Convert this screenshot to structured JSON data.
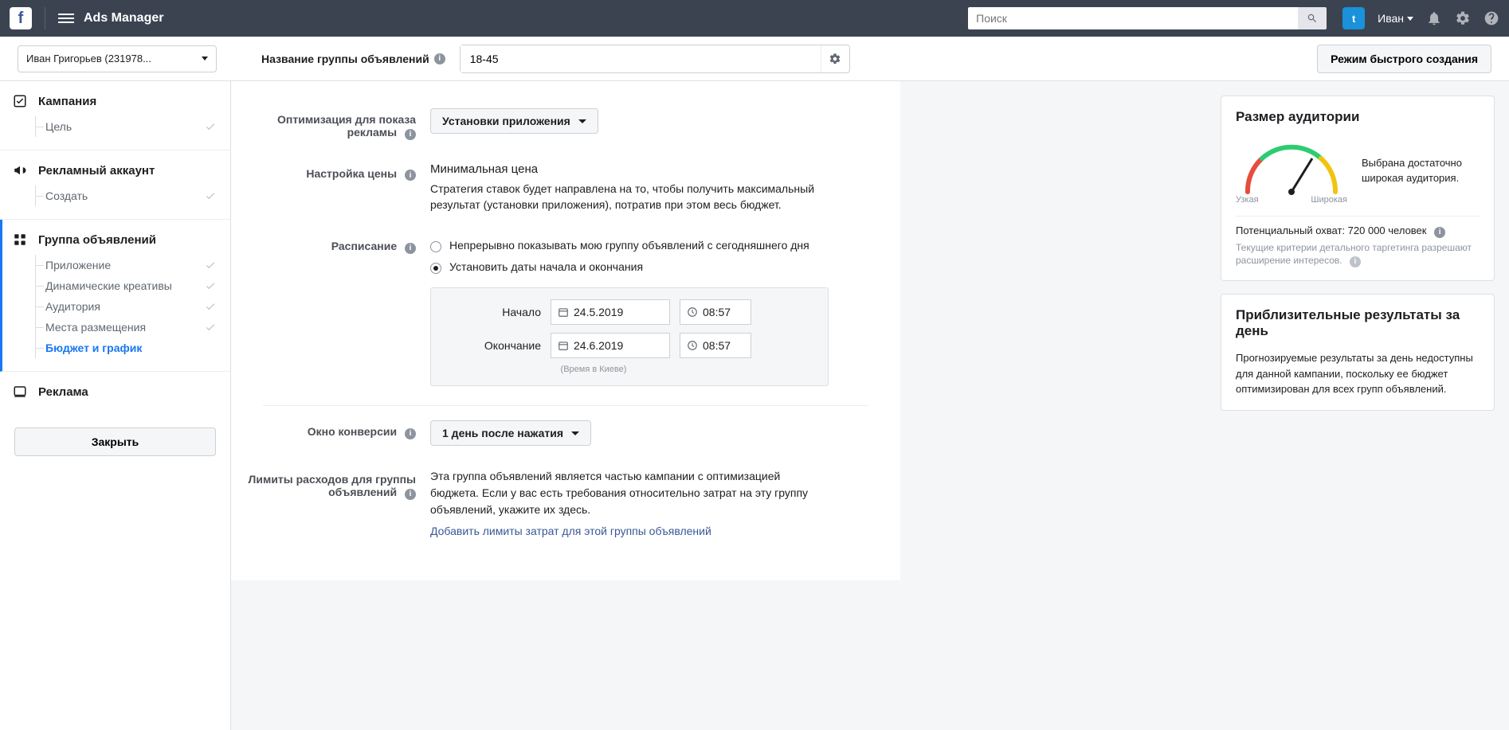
{
  "topbar": {
    "title": "Ads Manager",
    "search_placeholder": "Поиск",
    "user_name": "Иван"
  },
  "secondbar": {
    "account": "Иван Григорьев (231978...",
    "adset_label": "Название группы объявлений",
    "adset_value": "18-45",
    "quick_button": "Режим быстрого создания"
  },
  "sidebar": {
    "campaign": {
      "title": "Кампания",
      "sub_goal": "Цель"
    },
    "adaccount": {
      "title": "Рекламный аккаунт",
      "sub_create": "Создать"
    },
    "adset": {
      "title": "Группа объявлений",
      "subs": {
        "app": "Приложение",
        "dynamic": "Динамические креативы",
        "audience": "Аудитория",
        "placements": "Места размещения",
        "budget": "Бюджет и график"
      }
    },
    "ad": {
      "title": "Реклама"
    },
    "close": "Закрыть"
  },
  "form": {
    "optimization": {
      "label": "Оптимизация для показа рекламы",
      "value": "Установки приложения"
    },
    "price": {
      "label": "Настройка цены",
      "title": "Минимальная цена",
      "desc": "Стратегия ставок будет направлена на то, чтобы получить максимальный результат (установки приложения), потратив при этом весь бюджет."
    },
    "schedule": {
      "label": "Расписание",
      "opt_continuous": "Непрерывно показывать мою группу объявлений с сегодняшнего дня",
      "opt_dates": "Установить даты начала и окончания",
      "start_label": "Начало",
      "end_label": "Окончание",
      "start_date": "24.5.2019",
      "end_date": "24.6.2019",
      "start_time": "08:57",
      "end_time": "08:57",
      "tz": "(Время в Киеве)"
    },
    "window": {
      "label": "Окно конверсии",
      "value": "1 день после нажатия"
    },
    "limits": {
      "label": "Лимиты расходов для группы объявлений",
      "text": "Эта группа объявлений является частью кампании с оптимизацией бюджета. Если у вас есть требования относительно затрат на эту группу объявлений, укажите их здесь.",
      "link": "Добавить лимиты затрат для этой группы объявлений"
    }
  },
  "aside": {
    "size": {
      "title": "Размер аудитории",
      "gauge_narrow": "Узкая",
      "gauge_wide": "Широкая",
      "summary": "Выбрана достаточно широкая аудитория.",
      "reach_label": "Потенциальный охват: 720 000 человек",
      "hint": "Текущие критерии детального таргетинга разрешают расширение интересов."
    },
    "results": {
      "title": "Приблизительные результаты за день",
      "text": "Прогнозируемые результаты за день недоступны для данной кампании, поскольку ее бюджет оптимизирован для всех групп объявлений."
    }
  }
}
